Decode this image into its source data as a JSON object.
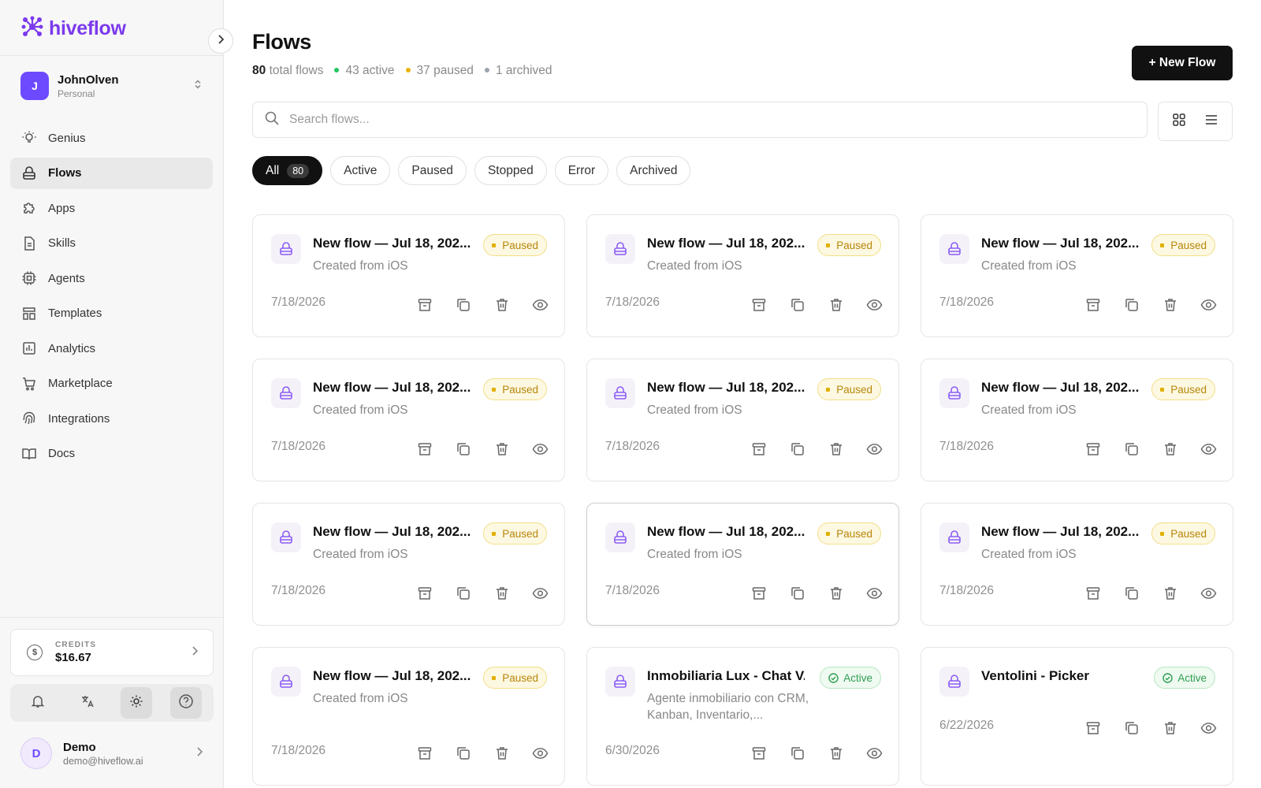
{
  "brand": {
    "name": "hiveflow",
    "color": "#7c3aed"
  },
  "account": {
    "initial": "J",
    "name": "JohnOlven",
    "type": "Personal"
  },
  "nav": [
    {
      "label": "Genius",
      "icon": "lightbulb-icon"
    },
    {
      "label": "Flows",
      "icon": "flows-icon",
      "active": true
    },
    {
      "label": "Apps",
      "icon": "puzzle-icon"
    },
    {
      "label": "Skills",
      "icon": "document-icon"
    },
    {
      "label": "Agents",
      "icon": "chip-icon"
    },
    {
      "label": "Templates",
      "icon": "templates-icon"
    },
    {
      "label": "Analytics",
      "icon": "chart-icon"
    },
    {
      "label": "Marketplace",
      "icon": "cart-icon"
    },
    {
      "label": "Integrations",
      "icon": "fingerprint-icon"
    },
    {
      "label": "Docs",
      "icon": "book-icon"
    }
  ],
  "credits": {
    "label": "CREDITS",
    "value": "$16.67"
  },
  "user": {
    "initial": "D",
    "name": "Demo",
    "email": "demo@hiveflow.ai"
  },
  "page": {
    "title": "Flows",
    "stats": {
      "total_count": "80",
      "total_suffix": "total flows",
      "active": "43 active",
      "paused": "37 paused",
      "archived": "1 archived"
    },
    "new_button": "+ New Flow",
    "search_placeholder": "Search flows..."
  },
  "filters": [
    {
      "label": "All",
      "count": "80",
      "active": true
    },
    {
      "label": "Active"
    },
    {
      "label": "Paused"
    },
    {
      "label": "Stopped"
    },
    {
      "label": "Error"
    },
    {
      "label": "Archived"
    }
  ],
  "colors": {
    "active_dot": "#22c55e",
    "paused_dot": "#eab308",
    "archived_dot": "#9ca3af"
  },
  "flows": [
    {
      "title": "New flow — Jul 18, 202...",
      "subtitle": "Created from iOS",
      "status": "Paused",
      "date": "7/18/2026"
    },
    {
      "title": "New flow — Jul 18, 202...",
      "subtitle": "Created from iOS",
      "status": "Paused",
      "date": "7/18/2026"
    },
    {
      "title": "New flow — Jul 18, 202...",
      "subtitle": "Created from iOS",
      "status": "Paused",
      "date": "7/18/2026"
    },
    {
      "title": "New flow — Jul 18, 202...",
      "subtitle": "Created from iOS",
      "status": "Paused",
      "date": "7/18/2026"
    },
    {
      "title": "New flow — Jul 18, 202...",
      "subtitle": "Created from iOS",
      "status": "Paused",
      "date": "7/18/2026"
    },
    {
      "title": "New flow — Jul 18, 202...",
      "subtitle": "Created from iOS",
      "status": "Paused",
      "date": "7/18/2026"
    },
    {
      "title": "New flow — Jul 18, 202...",
      "subtitle": "Created from iOS",
      "status": "Paused",
      "date": "7/18/2026"
    },
    {
      "title": "New flow — Jul 18, 202...",
      "subtitle": "Created from iOS",
      "status": "Paused",
      "date": "7/18/2026"
    },
    {
      "title": "New flow — Jul 18, 202...",
      "subtitle": "Created from iOS",
      "status": "Paused",
      "date": "7/18/2026"
    },
    {
      "title": "New flow — Jul 18, 202...",
      "subtitle": "Created from iOS",
      "status": "Paused",
      "date": "7/18/2026"
    },
    {
      "title": "Inmobiliaria Lux - Chat V...",
      "subtitle": "Agente inmobiliario con CRM, Kanban, Inventario,...",
      "status": "Active",
      "date": "6/30/2026"
    },
    {
      "title": "Ventolini - Picker",
      "subtitle": "",
      "status": "Active",
      "date": "6/22/2026"
    }
  ]
}
